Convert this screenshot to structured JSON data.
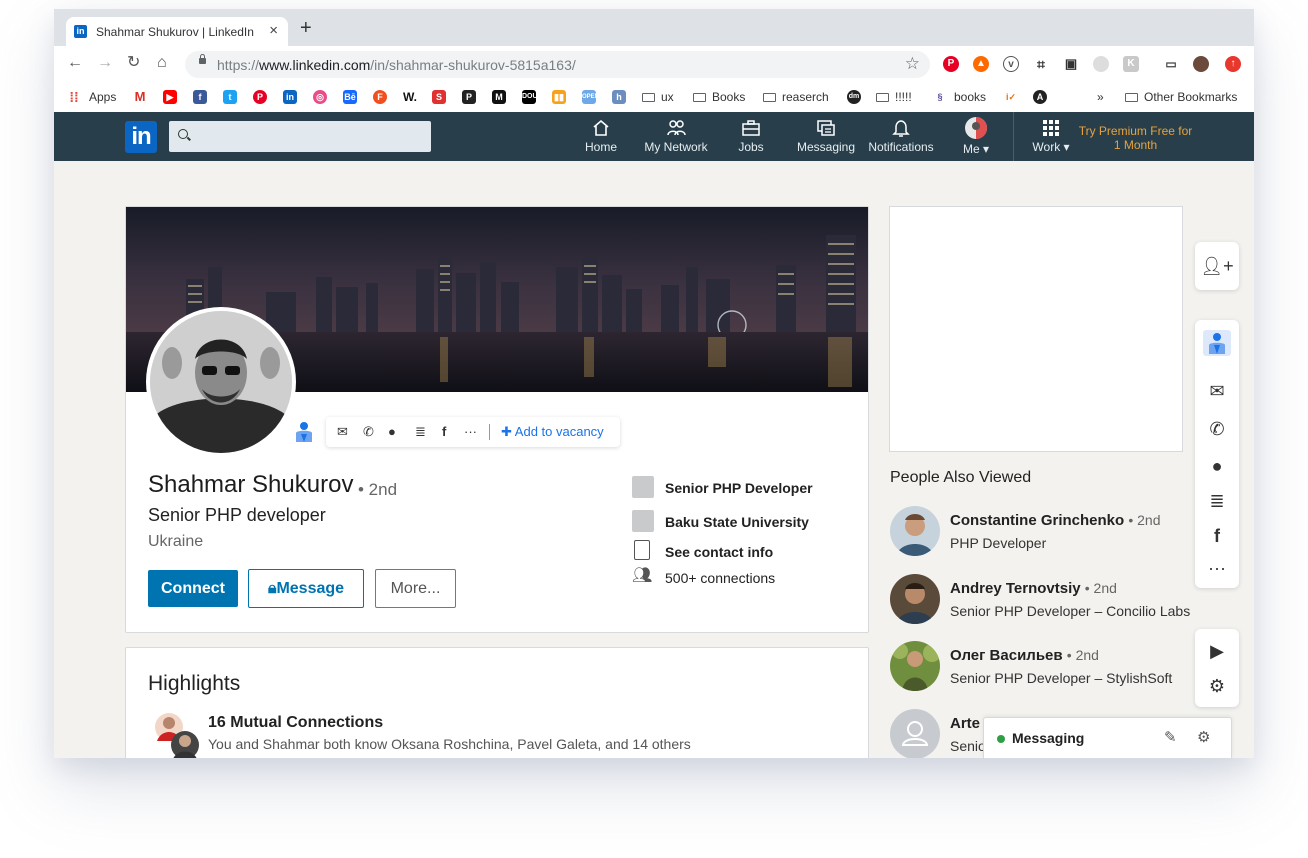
{
  "browser": {
    "tab_title": "Shahmar Shukurov | LinkedIn",
    "tab_close": "×",
    "new_tab": "+",
    "url_prefix": "https://",
    "url_host": "www.linkedin.com",
    "url_path": "/in/shahmar-shukurov-5815a163/",
    "bookmarks": {
      "apps": "Apps",
      "ux": "ux",
      "books": "Books",
      "reaserch": "reaserch",
      "marks": "!!!!!",
      "books2": "books",
      "overflow": "»",
      "other": "Other Bookmarks"
    }
  },
  "linkedin_nav": {
    "logo": "in",
    "items": [
      {
        "label": "Home",
        "icon": "home-icon"
      },
      {
        "label": "My Network",
        "icon": "network-icon"
      },
      {
        "label": "Jobs",
        "icon": "briefcase-icon"
      },
      {
        "label": "Messaging",
        "icon": "messaging-icon"
      },
      {
        "label": "Notifications",
        "icon": "bell-icon"
      },
      {
        "label": "Me ▾",
        "icon": "avatar"
      },
      {
        "label": "Work ▾",
        "icon": "grid-icon"
      }
    ],
    "premium": "Try Premium Free for 1 Month",
    "colors": {
      "nav_bg": "#283e4a",
      "premium": "#e7a33e",
      "brand": "#0a66c2"
    }
  },
  "profile": {
    "name": "Shahmar Shukurov",
    "degree": "• 2nd",
    "headline": "Senior PHP developer",
    "location": "Ukraine",
    "quick_actions": {
      "add_to_vacancy": "Add to vacancy",
      "icons": [
        "mail-icon",
        "phone-icon",
        "github-icon",
        "stackoverflow-icon",
        "facebook-icon",
        "more-icon"
      ]
    },
    "buttons": {
      "connect": "Connect",
      "message": "Message",
      "more": "More..."
    },
    "facts": {
      "position": "Senior PHP Developer",
      "school": "Baku State University",
      "contact": "See contact info",
      "connections": "500+ connections"
    }
  },
  "highlights": {
    "title": "Highlights",
    "mutual_title": "16 Mutual Connections",
    "mutual_desc": "You and Shahmar both know Oksana Roshchina, Pavel Galeta, and 14 others"
  },
  "people_also_viewed": {
    "title": "People Also Viewed",
    "people": [
      {
        "name": "Constantine Grinchenko",
        "degree": "• 2nd",
        "headline": "PHP Developer"
      },
      {
        "name": "Andrey Ternovtsiy",
        "degree": "• 2nd",
        "headline": "Senior PHP Developer – Concilio Labs"
      },
      {
        "name": "Олег Васильев",
        "degree": "• 2nd",
        "headline": "Senior PHP Developer – StylishSoft"
      },
      {
        "name": "Arte",
        "degree": "",
        "headline": "Senio"
      }
    ]
  },
  "messaging": {
    "label": "Messaging",
    "status_color": "#2f9e44"
  }
}
